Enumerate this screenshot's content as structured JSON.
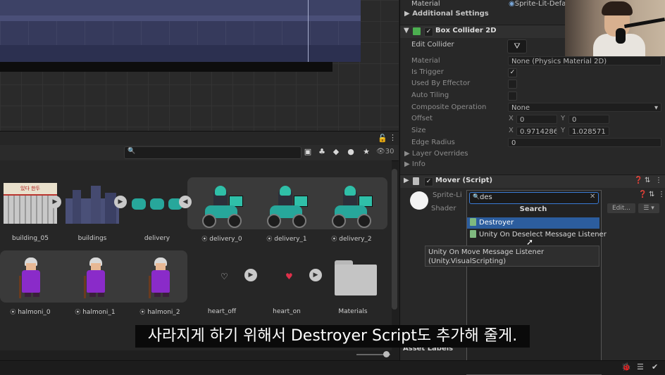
{
  "inspector": {
    "material_top_label": "Material",
    "material_top_value": "Sprite-Lit-Defa",
    "additional_settings": "Additional Settings",
    "box_collider": {
      "title": "Box Collider 2D",
      "edit_collider": "Edit Collider",
      "material_label": "Material",
      "material_value": "None (Physics Material 2D)",
      "is_trigger": "Is Trigger",
      "used_by_effector": "Used By Effector",
      "auto_tiling": "Auto Tiling",
      "composite_operation": "Composite Operation",
      "composite_value": "None",
      "offset": "Offset",
      "offset_x_label": "X",
      "offset_x": "0",
      "offset_y_label": "Y",
      "offset_y": "0",
      "size": "Size",
      "size_x_label": "X",
      "size_x": "0.9714286",
      "size_y_label": "Y",
      "size_y": "1.028571",
      "edge_radius": "Edge Radius",
      "edge_radius_value": "0",
      "layer_overrides": "Layer Overrides",
      "info": "Info"
    },
    "mover": {
      "title": "Mover (Script)"
    },
    "sprite_lit": "Sprite-Li",
    "shader_label": "Shader",
    "edit_button": "Edit...",
    "asset_labels": "Asset Labels"
  },
  "popup": {
    "search_value": "des",
    "title": "Search",
    "items": [
      {
        "label": "Destroyer"
      },
      {
        "label": "Unity On Deselect Message Listener"
      }
    ],
    "tooltip_line1": "Unity On Move Message Listener",
    "tooltip_line2": "(Unity.VisualScripting)"
  },
  "project": {
    "hidden_count": "30",
    "assets": [
      {
        "label": "building_05"
      },
      {
        "label": "buildings"
      },
      {
        "label": "delivery"
      },
      {
        "label": "delivery_0"
      },
      {
        "label": "delivery_1"
      },
      {
        "label": "delivery_2"
      },
      {
        "label": "halmoni_0"
      },
      {
        "label": "halmoni_1"
      },
      {
        "label": "halmoni_2"
      },
      {
        "label": "heart_off"
      },
      {
        "label": "heart_on"
      },
      {
        "label": "Materials"
      }
    ],
    "building_sign": "있다 한두"
  },
  "subtitle": "사라지게 하기 위해서 Destroyer Script도 추가해 줄게.",
  "colors": {
    "accent_blue": "#2c5d9e",
    "teal": "#27a79b",
    "purple": "#8a2bc9"
  }
}
